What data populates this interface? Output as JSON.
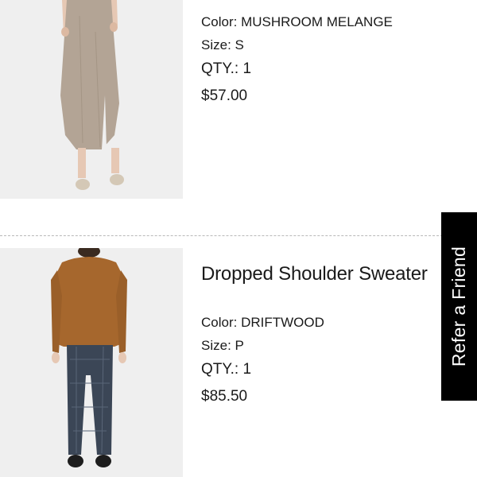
{
  "items": [
    {
      "image_alt": "model wearing a mushroom melange knit midi dress with sandals",
      "color_label": "Color:",
      "color_value": "MUSHROOM MELANGE",
      "size_label": "Size:",
      "size_value": "S",
      "qty_label": "QTY.:",
      "qty_value": "1",
      "price": "$57.00",
      "colors": {
        "garment": "#b3a495",
        "shoes": "#d4c8b6",
        "skin": "#e6c8b4",
        "background": "#efefef"
      }
    },
    {
      "name": "Dropped Shoulder Sweater",
      "image_alt": "model wearing a driftwood dropped shoulder sweater with plaid trousers",
      "color_label": "Color:",
      "color_value": "DRIFTWOOD",
      "size_label": "Size:",
      "size_value": "P",
      "qty_label": "QTY.:",
      "qty_value": "1",
      "price": "$85.50",
      "colors": {
        "garment": "#a6672d",
        "trousers": "#3b4656",
        "shoes": "#1d1d1d",
        "background": "#efefef"
      }
    }
  ],
  "refer_tab": {
    "label": "Refer a Friend",
    "background": "#000000",
    "text_color": "#ffffff"
  }
}
